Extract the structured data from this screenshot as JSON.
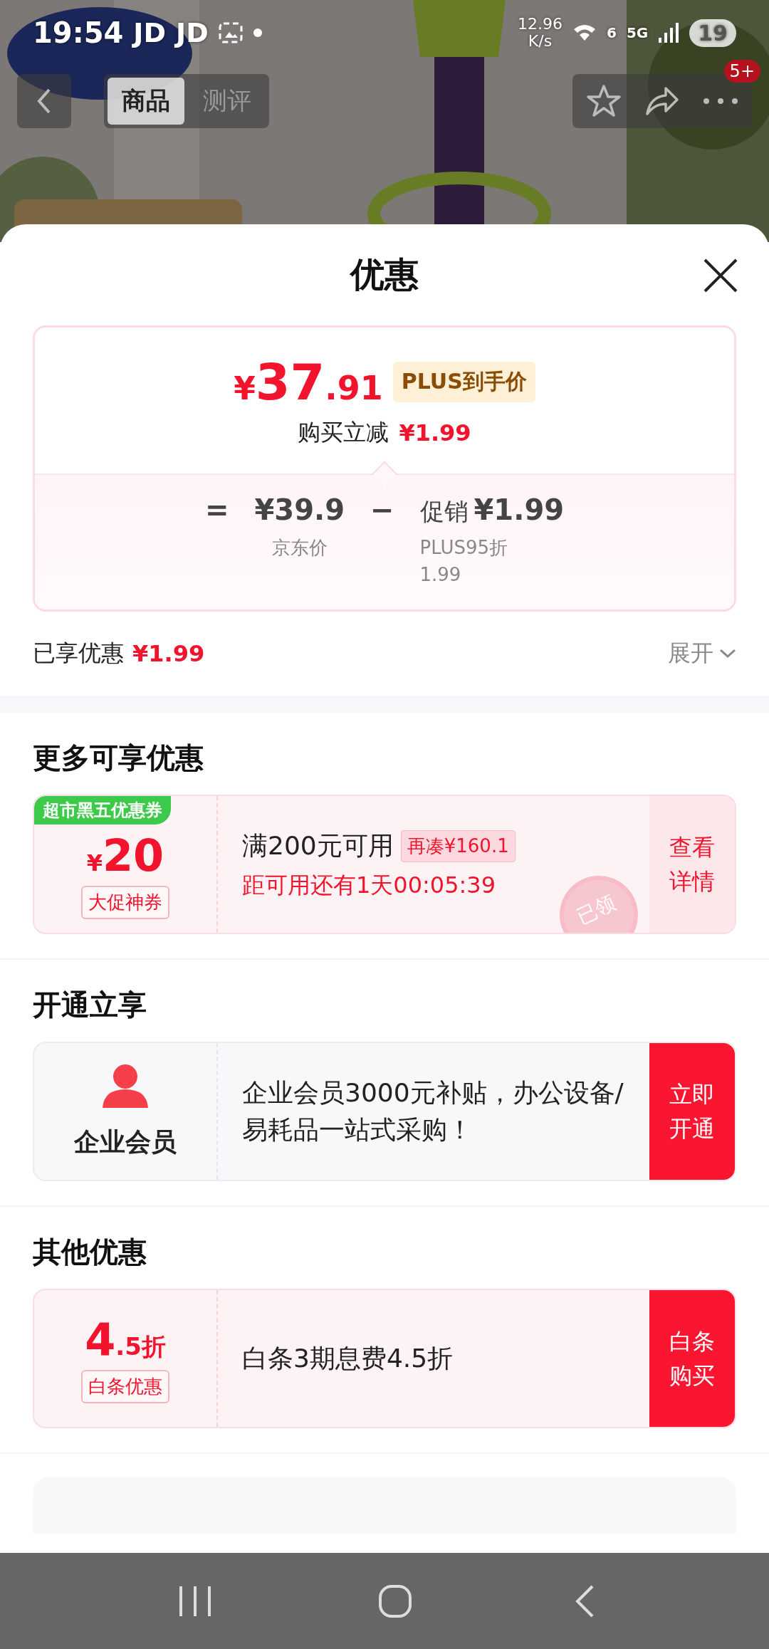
{
  "status_bar": {
    "time": "19:54",
    "notifications": [
      "JD",
      "JD"
    ],
    "speed": "12.96",
    "speed_unit": "K/s",
    "wifi_label": "6",
    "network": "5G",
    "battery": "19"
  },
  "top_nav": {
    "tabs": [
      {
        "label": "商品",
        "selected": true
      },
      {
        "label": "测评",
        "selected": false
      }
    ],
    "badge": "5+"
  },
  "sheet": {
    "title": "优惠"
  },
  "price_card": {
    "currency": "¥",
    "price_main": "37",
    "price_decimal": ".91",
    "tag": "PLUS到手价",
    "reduction_label": "购买立减",
    "reduction_value": "¥1.99",
    "equals": "=",
    "base_price": "¥39.9",
    "base_label": "京东价",
    "minus": "−",
    "promo_label": "促销",
    "promo_value": "¥1.99",
    "promo_notes": [
      "PLUS95折",
      "1.99"
    ]
  },
  "enjoyed": {
    "label": "已享优惠",
    "value": "¥1.99",
    "expand": "展开"
  },
  "sections": [
    {
      "title": "更多可享优惠",
      "card": {
        "kind": "coupon",
        "ribbon": "超市黑五优惠券",
        "currency": "¥",
        "amount": "20",
        "tag": "大促神券",
        "main": "满200元可用",
        "chip": "再凑¥160.1",
        "sub": "距可用还有1天00:05:39",
        "action": "查看详情",
        "stamp": "已领"
      }
    },
    {
      "title": "开通立享",
      "card": {
        "kind": "member",
        "name": "企业会员",
        "main": "企业会员3000元补贴，办公设备/易耗品一站式采购！",
        "action": "立即开通"
      }
    },
    {
      "title": "其他优惠",
      "card": {
        "kind": "discount",
        "amount": "4",
        "amount_suffix": ".5折",
        "tag": "白条优惠",
        "main": "白条3期息费4.5折",
        "action": "白条购买"
      }
    }
  ]
}
